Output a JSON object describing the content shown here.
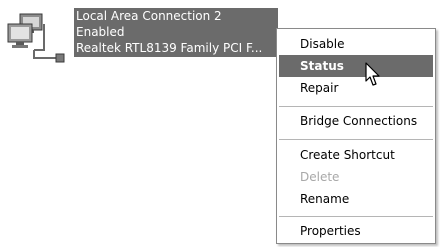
{
  "connection": {
    "name": "Local Area Connection 2",
    "status": "Enabled",
    "adapter": "Realtek RTL8139 Family PCI F..."
  },
  "context_menu": {
    "items": [
      {
        "label": "Disable"
      },
      {
        "label": "Status",
        "bold": true,
        "highlighted": true
      },
      {
        "label": "Repair"
      },
      {
        "label": "Bridge Connections"
      },
      {
        "label": "Create Shortcut"
      },
      {
        "label": "Delete",
        "disabled": true
      },
      {
        "label": "Rename"
      },
      {
        "label": "Properties"
      }
    ]
  },
  "icons": {
    "connection": "network-connection-icon",
    "cursor": "mouse-pointer-icon"
  },
  "colors": {
    "selection": "#6b6b6b",
    "disabled_text": "#a8a8a8",
    "menu_border": "#8a8a8a"
  }
}
